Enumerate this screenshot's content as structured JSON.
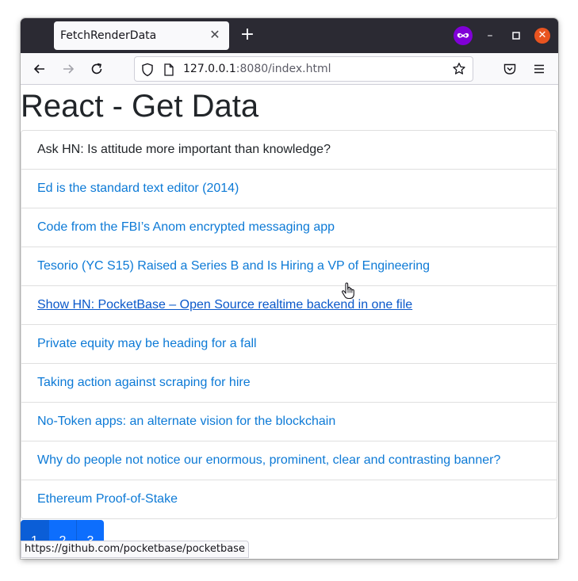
{
  "browser": {
    "tab_title": "FetchRenderData",
    "url_host": "127.0.0.1",
    "url_rest": ":8080/index.html",
    "accent_private": "#8000d7",
    "close_color": "#e95420"
  },
  "page": {
    "title": "React - Get Data",
    "items": [
      {
        "label": "Ask HN: Is attitude more important than knowledge?",
        "type": "text"
      },
      {
        "label": "Ed is the standard text editor (2014)",
        "type": "link"
      },
      {
        "label": "Code from the FBI’s Anom encrypted messaging app",
        "type": "link"
      },
      {
        "label": "Tesorio (YC S15) Raised a Series B and Is Hiring a VP of Engineering",
        "type": "link"
      },
      {
        "label": "Show HN: PocketBase – Open Source realtime backend in one file",
        "type": "link-hovered"
      },
      {
        "label": "Private equity may be heading for a fall",
        "type": "link"
      },
      {
        "label": "Taking action against scraping for hire",
        "type": "link"
      },
      {
        "label": "No-Token apps: an alternate vision for the blockchain",
        "type": "link"
      },
      {
        "label": "Why do people not notice our enormous, prominent, clear and contrasting banner?",
        "type": "link"
      },
      {
        "label": "Ethereum Proof-of-Stake",
        "type": "link"
      }
    ],
    "pages": [
      "1",
      "2",
      "3"
    ],
    "link_color": "#0d7ad6",
    "button_color": "#0d6efd"
  },
  "status_bar": {
    "hover_url": "https://github.com/pocketbase/pocketbase"
  }
}
